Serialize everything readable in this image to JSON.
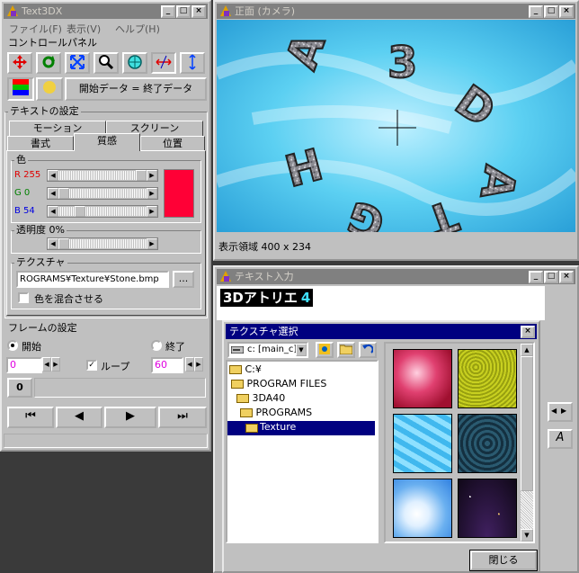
{
  "left_window": {
    "title": "Text3DX",
    "menu": [
      "ファイル(F)",
      "表示(V)",
      "ヘルプ(H)"
    ],
    "control_panel_label": "コントロールパネル",
    "start_end_button": "開始データ = 終了データ",
    "text_settings_label": "テキストの設定",
    "tabs_row1": [
      "モーション",
      "スクリーン"
    ],
    "tabs_row2": [
      "書式",
      "質感",
      "位置"
    ],
    "color_label": "色",
    "r_label": "R 255",
    "g_label": "G 0",
    "b_label": "B 54",
    "r_value": 255,
    "g_value": 0,
    "b_value": 54,
    "swatch_color": "#ff0036",
    "opacity_label": "透明度 0%",
    "opacity_value": 0,
    "texture_label": "テクスチャ",
    "texture_path": "ROGRAMS¥Texture¥Stone.bmp",
    "browse_button": "...",
    "mix_color_label": "色を混合させる",
    "frame_settings_label": "フレームの設定",
    "start_label": "開始",
    "end_label": "終了",
    "start_frame": "0",
    "end_frame": "60",
    "loop_label": "ループ",
    "current_frame": "0"
  },
  "viewport_window": {
    "title": "正面 (カメラ)",
    "status": "表示領域 400 x 234",
    "letters": [
      "3",
      "D",
      "A",
      "T",
      "G",
      "H",
      "A"
    ]
  },
  "text_input_window": {
    "title": "テキスト入力",
    "logo_text": "3Dアトリエ",
    "logo_number": "4"
  },
  "texture_dialog": {
    "title": "テクスチャ選択",
    "drive": "c: [main_c]",
    "tree": [
      "C:¥",
      "PROGRAM FILES",
      "3DA40",
      "PROGRAMS",
      "Texture"
    ],
    "selected_folder": "Texture",
    "close_button": "閉じる"
  },
  "colors": {
    "titlebar_inactive": "#808080",
    "titlebar_active": "#000080",
    "face": "#c0c0c0",
    "sky": "#4fc8ee"
  }
}
